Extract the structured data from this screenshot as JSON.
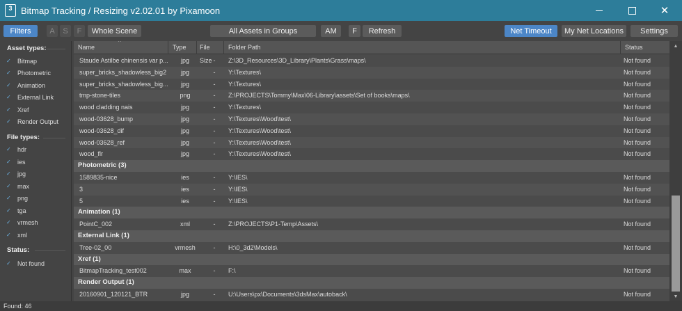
{
  "window": {
    "title": "Bitmap Tracking / Resizing  v2.02.01  by Pixamoon",
    "icon_text": "3",
    "minimize_icon": "minimize-icon",
    "maximize_icon": "maximize-icon",
    "close_icon": "close-icon",
    "close_glyph": "✕"
  },
  "toolbar": {
    "filters": "Filters",
    "a": "A",
    "s": "S",
    "f": "F",
    "whole_scene": "Whole Scene",
    "all_assets": "All Assets in Groups",
    "am": "AM",
    "f2": "F",
    "refresh": "Refresh",
    "net_timeout": "Net Timeout",
    "my_net_locations": "My Net Locations",
    "settings": "Settings",
    "accent": "#4c86c7"
  },
  "sidebar": {
    "asset_types_label": "Asset types:",
    "asset_types": [
      "Bitmap",
      "Photometric",
      "Animation",
      "External Link",
      "Xref",
      "Render Output"
    ],
    "file_types_label": "File types:",
    "file_types": [
      "hdr",
      "ies",
      "jpg",
      "max",
      "png",
      "tga",
      "vrmesh",
      "xml"
    ],
    "status_label": "Status:",
    "status_items": [
      "Not found"
    ],
    "check_glyph": "✓"
  },
  "table": {
    "headers": {
      "name": "Name",
      "type": "Type",
      "size": "File Size",
      "path": "Folder Path",
      "status": "Status"
    },
    "sort_glyph": "^",
    "rows": [
      {
        "kind": "item",
        "name": "Staude Astilbe chinensis var p...",
        "type": "jpg",
        "size": "-",
        "path": "Z:\\3D_Resources\\3D_Library\\Plants\\Grass\\maps\\",
        "status": "Not found"
      },
      {
        "kind": "item",
        "name": "super_bricks_shadowless_big2",
        "type": "jpg",
        "size": "-",
        "path": "Y:\\Textures\\",
        "status": "Not found"
      },
      {
        "kind": "item",
        "name": "super_bricks_shadowless_big...",
        "type": "jpg",
        "size": "-",
        "path": "Y:\\Textures\\",
        "status": "Not found"
      },
      {
        "kind": "item",
        "name": "tmp-stone-tiles",
        "type": "png",
        "size": "-",
        "path": "Z:\\PROJECTS\\Tommy\\Max\\06-Library\\assets\\Set of books\\maps\\",
        "status": "Not found"
      },
      {
        "kind": "item",
        "name": "wood cladding nais",
        "type": "jpg",
        "size": "-",
        "path": "Y:\\Textures\\",
        "status": "Not found"
      },
      {
        "kind": "item",
        "name": "wood-03628_bump",
        "type": "jpg",
        "size": "-",
        "path": "Y:\\Textures\\Wood\\test\\",
        "status": "Not found"
      },
      {
        "kind": "item",
        "name": "wood-03628_dif",
        "type": "jpg",
        "size": "-",
        "path": "Y:\\Textures\\Wood\\test\\",
        "status": "Not found"
      },
      {
        "kind": "item",
        "name": "wood-03628_ref",
        "type": "jpg",
        "size": "-",
        "path": "Y:\\Textures\\Wood\\test\\",
        "status": "Not found"
      },
      {
        "kind": "item",
        "name": "wood_flr",
        "type": "jpg",
        "size": "-",
        "path": "Y:\\Textures\\Wood\\test\\",
        "status": "Not found"
      },
      {
        "kind": "group",
        "name": "Photometric (3)"
      },
      {
        "kind": "item",
        "name": "1589835-nice",
        "type": "ies",
        "size": "-",
        "path": "Y:\\IES\\",
        "status": "Not found"
      },
      {
        "kind": "item",
        "name": "3",
        "type": "ies",
        "size": "-",
        "path": "Y:\\IES\\",
        "status": "Not found"
      },
      {
        "kind": "item",
        "name": "5",
        "type": "ies",
        "size": "-",
        "path": "Y:\\IES\\",
        "status": "Not found"
      },
      {
        "kind": "group",
        "name": "Animation (1)"
      },
      {
        "kind": "item",
        "name": "PointC_002",
        "type": "xml",
        "size": "-",
        "path": "Z:\\PROJECTS\\P1-Temp\\Assets\\",
        "status": "Not found"
      },
      {
        "kind": "group",
        "name": "External Link (1)"
      },
      {
        "kind": "item",
        "name": "Tree-02_00",
        "type": "vrmesh",
        "size": "-",
        "path": "H:\\0_3d2\\Models\\",
        "status": "Not found"
      },
      {
        "kind": "group",
        "name": "Xref (1)"
      },
      {
        "kind": "item",
        "name": "BitmapTracking_test002",
        "type": "max",
        "size": "-",
        "path": "F:\\",
        "status": "Not found"
      },
      {
        "kind": "group",
        "name": "Render Output (1)"
      },
      {
        "kind": "item",
        "name": "20160901_120121_BTR",
        "type": "jpg",
        "size": "-",
        "path": "U:\\Users\\px\\Documents\\3dsMax\\autoback\\",
        "status": "Not found"
      }
    ]
  },
  "scrollbar": {
    "up_glyph": "▲",
    "down_glyph": "▼"
  },
  "statusbar": {
    "found": "Found: 46"
  }
}
